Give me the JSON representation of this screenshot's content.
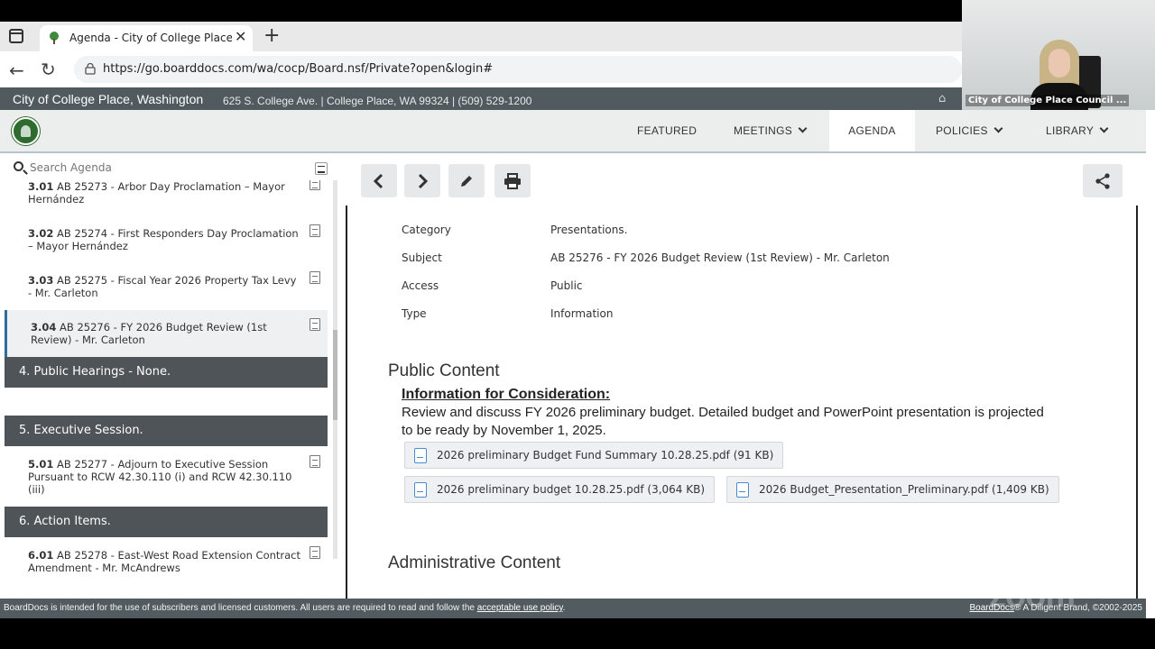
{
  "browser": {
    "tab_title": "Agenda - City of College Place, W",
    "tab_close": "✕",
    "new_tab": "+",
    "url": "https://go.boarddocs.com/wa/cocp/Board.nsf/Private?open&login#"
  },
  "zoom": {
    "participant_label": "City of College Place Council ...",
    "watermark": "zoom"
  },
  "site": {
    "name": "City of College Place, Washington",
    "address": "625 S. College Ave. | College Place, WA 99324 | (509) 529-1200"
  },
  "nav": {
    "featured": "FEATURED",
    "meetings": "MEETINGS",
    "agenda": "AGENDA",
    "policies": "POLICIES",
    "library": "LIBRARY"
  },
  "search": {
    "placeholder": "Search Agenda"
  },
  "agenda": {
    "item_301": {
      "num": "3.01",
      "text": " AB 25273 - Arbor Day Proclamation – Mayor Hernández"
    },
    "item_302": {
      "num": "3.02",
      "text": " AB 25274 - First Responders Day Proclamation – Mayor Hernández"
    },
    "item_303": {
      "num": "3.03",
      "text": " AB 25275 - Fiscal Year 2026 Property Tax Levy - Mr. Carleton"
    },
    "item_304": {
      "num": "3.04",
      "text": " AB 25276 - FY 2026 Budget Review (1st Review) - Mr. Carleton"
    },
    "section_4": "4. Public Hearings - None.",
    "section_5": "5. Executive Session.",
    "item_501": {
      "num": "5.01",
      "text": " AB 25277 - Adjourn to Executive Session Pursuant to RCW 42.30.110 (i) and RCW 42.30.110 (iii)"
    },
    "section_6": "6. Action Items.",
    "item_601": {
      "num": "6.01",
      "text": " AB 25278 - East-West Road Extension Contract Amendment - Mr. McAndrews"
    }
  },
  "detail": {
    "meta": [
      {
        "label": "Category",
        "value": "Presentations."
      },
      {
        "label": "Subject",
        "value": "AB 25276 - FY 2026 Budget Review (1st Review) - Mr. Carleton"
      },
      {
        "label": "Access",
        "value": "Public"
      },
      {
        "label": "Type",
        "value": "Information"
      }
    ],
    "public_content_heading": "Public Content",
    "info_title": "Information for Consideration:",
    "info_body": "Review and discuss FY 2026 preliminary budget. Detailed budget and PowerPoint presentation is projected to be ready by November 1, 2025.",
    "files": [
      "2026 preliminary Budget Fund Summary 10.28.25.pdf (91 KB)",
      "2026 preliminary budget 10.28.25.pdf (3,064 KB)",
      "2026 Budget_Presentation_Preliminary.pdf (1,409 KB)"
    ],
    "admin_content_heading": "Administrative Content"
  },
  "footer": {
    "text_prefix": "BoardDocs is intended for the use of subscribers and licensed customers. All users are required to read and follow the ",
    "policy_link": "acceptable use policy",
    "text_suffix": ".",
    "right_link": "BoardDocs",
    "right_text": "® A Diligent Brand, ©2002-2025"
  }
}
